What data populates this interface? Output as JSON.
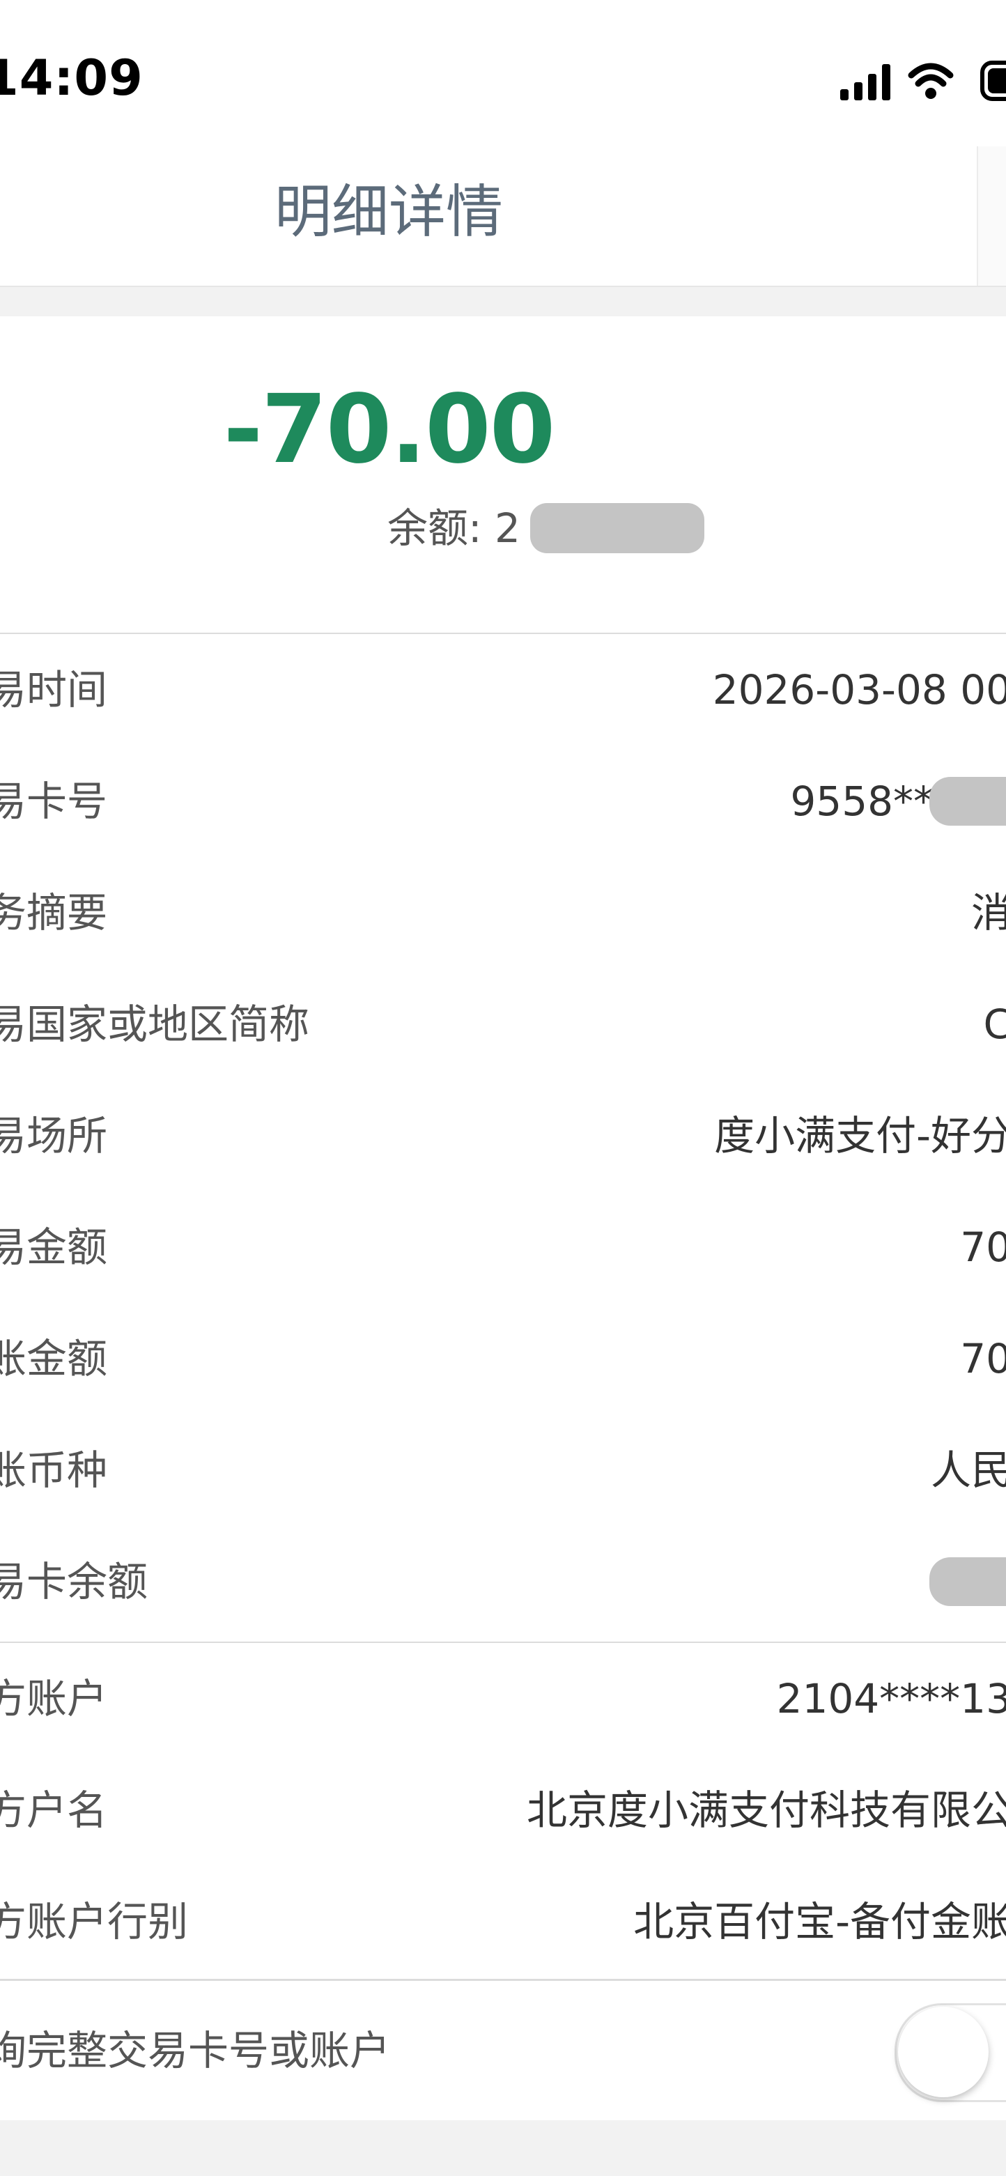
{
  "status_bar": {
    "time": "14:09",
    "icons": [
      "signal-bars-icon",
      "wifi-icon",
      "battery-icon"
    ]
  },
  "nav": {
    "title": "明细详情"
  },
  "summary": {
    "amount": "-70.00",
    "amount_color": "#1e8a5c",
    "balance_label": "余额: 2"
  },
  "details": {
    "rows": [
      {
        "label": "易时间",
        "value": "2026-03-08 00"
      },
      {
        "label": "易卡号",
        "value": "9558**"
      },
      {
        "label": "务摘要",
        "value": "消"
      },
      {
        "label": "易国家或地区简称",
        "value": "C"
      },
      {
        "label": "易场所",
        "value": "度小满支付-好分"
      },
      {
        "label": "易金额",
        "value": "70"
      },
      {
        "label": "账金额",
        "value": "70"
      },
      {
        "label": "账币种",
        "value": "人民"
      },
      {
        "label": "易卡余额",
        "value": ""
      }
    ],
    "counterparty": [
      {
        "label": "方账户",
        "value": "2104****13"
      },
      {
        "label": "方户名",
        "value": "北京度小满支付科技有限公"
      },
      {
        "label": "方账户行别",
        "value": "北京百付宝-备付金账"
      }
    ],
    "toggle_row": {
      "label": "询完整交易卡号或账户",
      "checked": false
    }
  }
}
